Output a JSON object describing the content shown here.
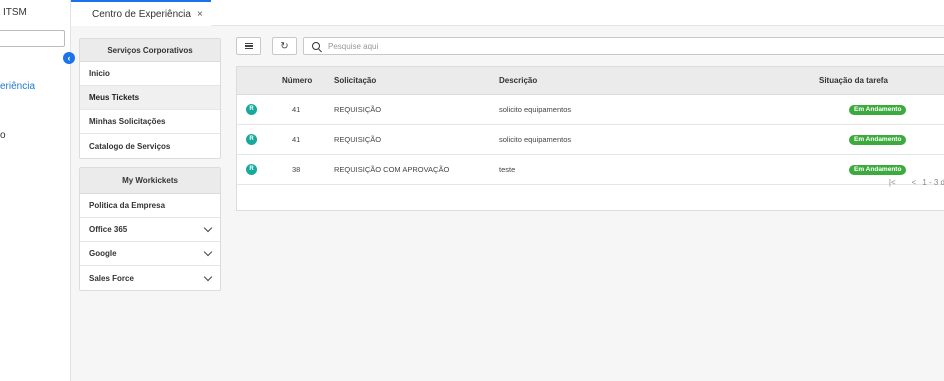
{
  "app": {
    "title": "ITSM",
    "search_value": ""
  },
  "sidebar": {
    "items": [
      {
        "label": "eriência"
      },
      {
        "label": "o"
      }
    ]
  },
  "tabs": [
    {
      "label": "Centro de Experiência",
      "close": "×"
    }
  ],
  "panels": [
    {
      "title": "Serviços Corporativos",
      "items": [
        {
          "label": "Inicio"
        },
        {
          "label": "Meus Tickets"
        },
        {
          "label": "Minhas Solicitações"
        },
        {
          "label": "Catalogo de Serviços"
        }
      ]
    },
    {
      "title": "My Workickets",
      "items": [
        {
          "label": "Politica da Empresa"
        },
        {
          "label": "Office 365"
        },
        {
          "label": "Google"
        },
        {
          "label": "Sales Force"
        }
      ]
    }
  ],
  "search": {
    "placeholder": "Pesquise aqui"
  },
  "table": {
    "columns": [
      "Número",
      "Solicitação",
      "Descrição",
      "Situação da tarefa"
    ],
    "rows": [
      {
        "badge": "R",
        "numero": "41",
        "solicitacao": "REQUISIÇÃO",
        "descricao": "solicito equipamentos",
        "situacao": "Em Andamento"
      },
      {
        "badge": "R",
        "numero": "41",
        "solicitacao": "REQUISIÇÃO",
        "descricao": "solicito equipamentos",
        "situacao": "Em Andamento"
      },
      {
        "badge": "R",
        "numero": "38",
        "solicitacao": "REQUISIÇÃO COM APROVAÇÃO",
        "descricao": "teste",
        "situacao": "Em Andamento"
      }
    ],
    "pager": {
      "first": "|<",
      "prev": "<",
      "range": "1 - 3 d"
    }
  },
  "colors": {
    "accent": "#1a73e8",
    "status_green": "#3caa3c",
    "badge_teal": "#18a99c"
  }
}
